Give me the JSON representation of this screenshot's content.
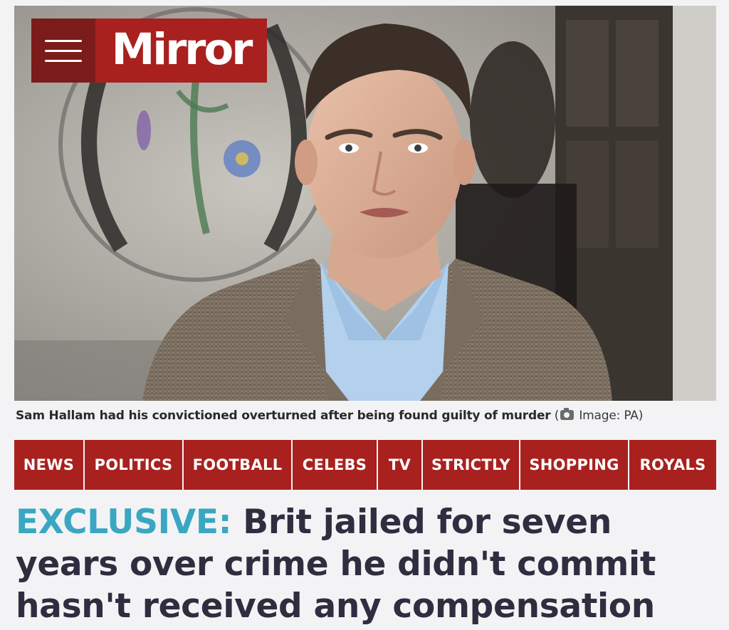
{
  "masthead": {
    "brand": "Mirror",
    "menu_icon": "hamburger-menu-icon",
    "colors": {
      "brand_red": "#a8211f",
      "menu_dark_red": "#7b1c1a"
    }
  },
  "hero": {
    "caption": "Sam Hallam had his convictioned overturned after being found guilty of murder",
    "credit_open": "(",
    "camera_icon": "camera-icon",
    "credit": "Image: PA)"
  },
  "nav": {
    "items": [
      {
        "label": "NEWS"
      },
      {
        "label": "POLITICS"
      },
      {
        "label": "FOOTBALL"
      },
      {
        "label": "CELEBS"
      },
      {
        "label": "TV"
      },
      {
        "label": "STRICTLY"
      },
      {
        "label": "SHOPPING"
      },
      {
        "label": "ROYALS"
      }
    ]
  },
  "article": {
    "kicker": "EXCLUSIVE:",
    "headline": "Brit jailed for seven years over crime he didn't commit hasn't received any compensation",
    "kicker_color": "#3aa7c2",
    "headline_color": "#2f2d3f"
  }
}
